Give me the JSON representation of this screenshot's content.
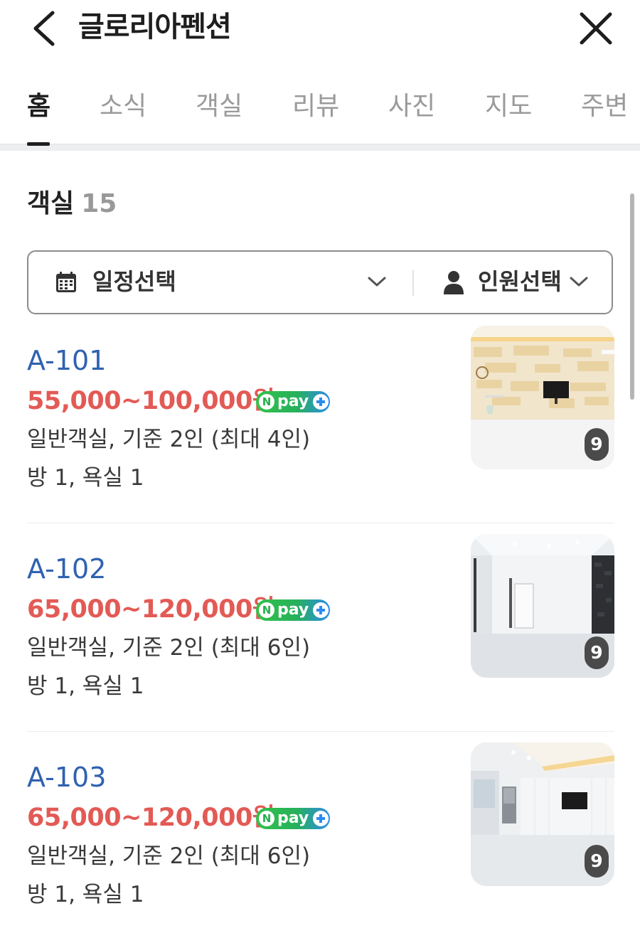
{
  "header": {
    "title": "글로리아펜션",
    "back_icon": "chevron-left-icon",
    "close_icon": "close-icon"
  },
  "tabs": [
    {
      "label": "홈",
      "active": true
    },
    {
      "label": "소식",
      "active": false
    },
    {
      "label": "객실",
      "active": false
    },
    {
      "label": "리뷰",
      "active": false
    },
    {
      "label": "사진",
      "active": false
    },
    {
      "label": "지도",
      "active": false
    },
    {
      "label": "주변",
      "active": false
    }
  ],
  "section": {
    "title": "객실",
    "count": "15"
  },
  "filter": {
    "date_label": "일정선택",
    "people_label": "인원선택",
    "date_icon": "calendar-icon",
    "people_icon": "person-icon"
  },
  "rooms": [
    {
      "name": "A-101",
      "price": "55,000~100,000원",
      "badge": "pay",
      "badge_n": "N",
      "desc": "일반객실, 기준 2인 (최대 4인)",
      "rooms_info": "방 1, 욕실 1",
      "photo_count": "9"
    },
    {
      "name": "A-102",
      "price": "65,000~120,000원",
      "badge": "pay",
      "badge_n": "N",
      "desc": "일반객실, 기준 2인 (최대 6인)",
      "rooms_info": "방 1, 욕실 1",
      "photo_count": "9"
    },
    {
      "name": "A-103",
      "price": "65,000~120,000원",
      "badge": "pay",
      "badge_n": "N",
      "desc": "일반객실, 기준 2인 (최대 6인)",
      "rooms_info": "방 1, 욕실 1",
      "photo_count": "9"
    }
  ],
  "colors": {
    "price": "#e35a55",
    "room_name": "#2f62b0",
    "npay_green": "#27b05b",
    "npay_blue": "#2b8cf0"
  }
}
